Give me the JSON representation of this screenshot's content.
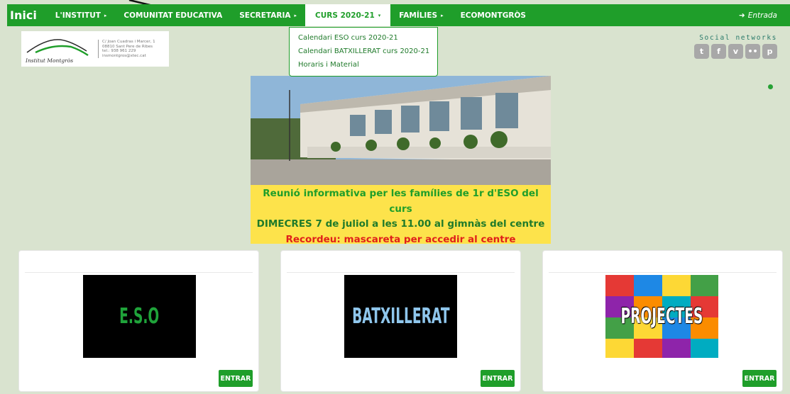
{
  "nav": {
    "brand": "Inici",
    "items": [
      {
        "label": "L'INSTITUT",
        "caret": "▸"
      },
      {
        "label": "COMUNITAT EDUCATIVA",
        "caret": ""
      },
      {
        "label": "SECRETARIA",
        "caret": "▸"
      },
      {
        "label": "CURS 2020-21",
        "caret": "▾"
      },
      {
        "label": "FAMÍLIES",
        "caret": "▸"
      },
      {
        "label": "ECOMONTGRÒS",
        "caret": ""
      }
    ],
    "login": "Entrada",
    "login_icon": "sign-in-icon"
  },
  "dropdown": {
    "items": [
      "Calendari ESO curs 2020-21",
      "Calendari BATXILLERAT curs 2020-21",
      "Horaris i Material"
    ]
  },
  "header": {
    "school_name": "Institut Montgròs",
    "address": "C/ Joan Cuadras i Marcer, 1\n08810 Sant Pere de Ribes\ntel.: 938 961 229\ninsmontgros@xtec.cat"
  },
  "social": {
    "title": "Social networks",
    "icons": [
      {
        "name": "twitter-icon",
        "glyph": "t"
      },
      {
        "name": "facebook-icon",
        "glyph": "f"
      },
      {
        "name": "vimeo-icon",
        "glyph": "v"
      },
      {
        "name": "flickr-icon",
        "glyph": "••"
      },
      {
        "name": "pinterest-icon",
        "glyph": "p"
      }
    ]
  },
  "banner": {
    "line1": "Reunió informativa per les famílies de 1r d'ESO del curs",
    "line2": "DIMECRES 7 de juliol a les 11.00 al gimnàs del centre",
    "line3": "Recordeu: mascareta per accedir al centre"
  },
  "cards": [
    {
      "image_text": "E.S.O",
      "button": "ENTRAR"
    },
    {
      "image_text": "BATXILLERAT",
      "button": "ENTRAR"
    },
    {
      "image_text": "PROJECTES",
      "button": "ENTRAR"
    }
  ],
  "colors": {
    "accent": "#1f9e2a",
    "background": "#d9e3cf",
    "banner_yellow": "#fde34b",
    "banner_red": "#e0201a"
  }
}
